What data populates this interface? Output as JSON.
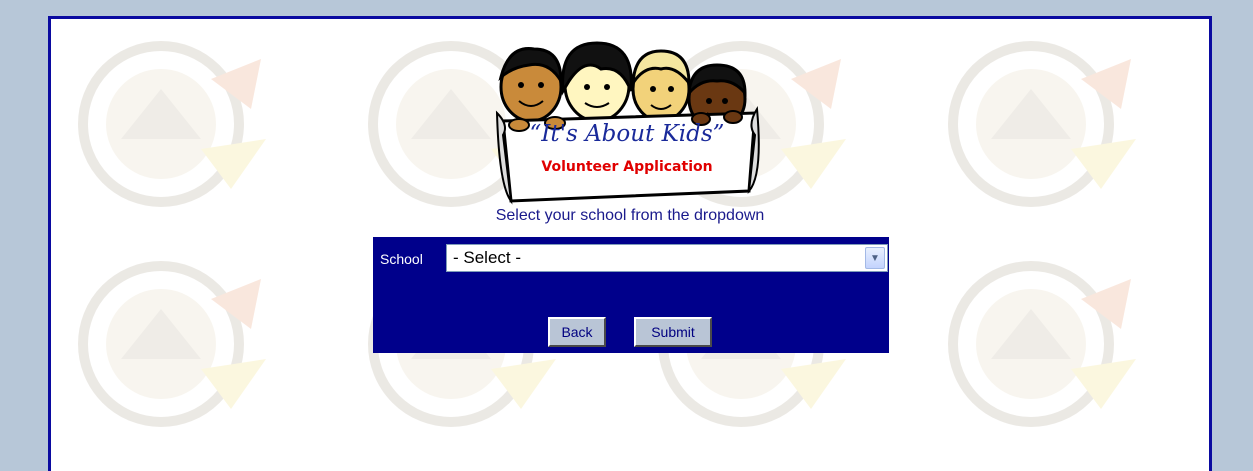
{
  "logo": {
    "title": "“It's About Kids”",
    "subtitle": "Volunteer Application"
  },
  "instruction": "Select your school from the dropdown",
  "form": {
    "school_label": "School",
    "school_select": {
      "selected": "- Select -"
    },
    "back_label": "Back",
    "submit_label": "Submit"
  },
  "colors": {
    "page_bg": "#b7c7d8",
    "border": "#0a0aa0",
    "panel": "#00008b",
    "logo_title": "#1a2a9a",
    "logo_subtitle": "#e00000"
  },
  "icons": {
    "dropdown": "chevron-down-icon",
    "watermark": "district-seal-watermark"
  }
}
